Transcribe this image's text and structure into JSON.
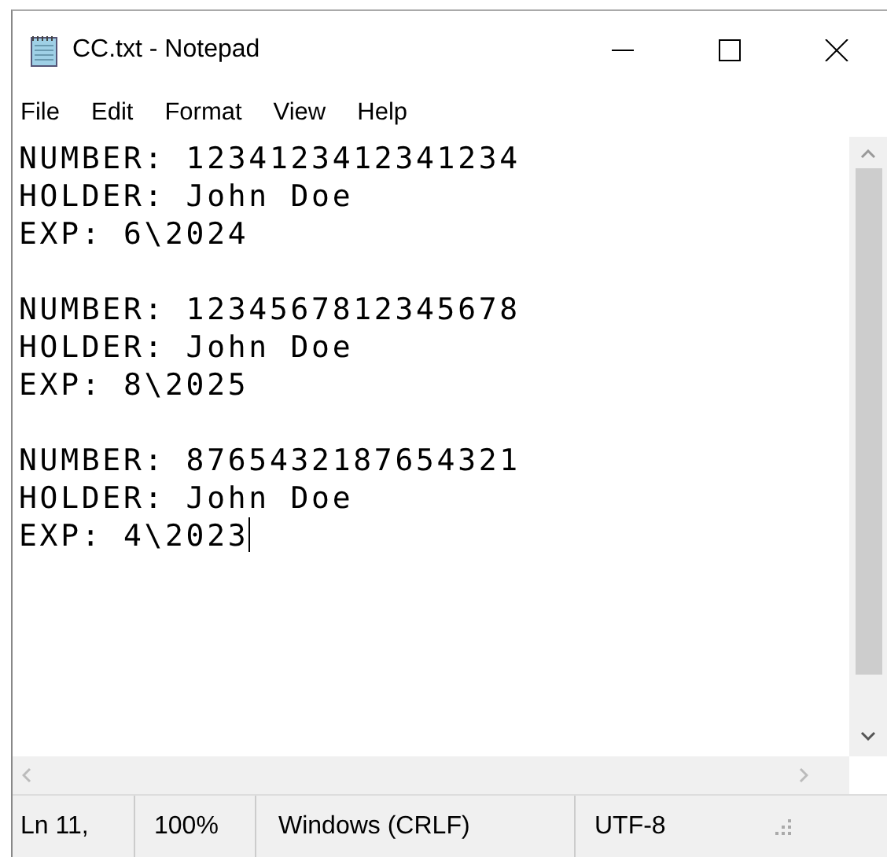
{
  "window": {
    "title": "CC.txt - Notepad"
  },
  "menu": [
    "File",
    "Edit",
    "Format",
    "View",
    "Help"
  ],
  "editor": {
    "blocks": [
      {
        "lines": [
          {
            "text": "NUMBER: 1234123412341234",
            "caret": false
          },
          {
            "text": "HOLDER: John Doe",
            "caret": false
          },
          {
            "text": "EXP: 6\\2024",
            "caret": false
          }
        ]
      },
      {
        "lines": [
          {
            "text": "NUMBER: 1234567812345678",
            "caret": false
          },
          {
            "text": "HOLDER: John Doe",
            "caret": false
          },
          {
            "text": "EXP: 8\\2025",
            "caret": false
          }
        ]
      },
      {
        "lines": [
          {
            "text": "NUMBER: 8765432187654321",
            "caret": false
          },
          {
            "text": "HOLDER: John Doe",
            "caret": false
          },
          {
            "text": "EXP: 4\\2023",
            "caret": true
          }
        ]
      }
    ]
  },
  "status_bar": [
    "Ln 11,",
    "100%",
    "Windows (CRLF)",
    "UTF-8"
  ]
}
